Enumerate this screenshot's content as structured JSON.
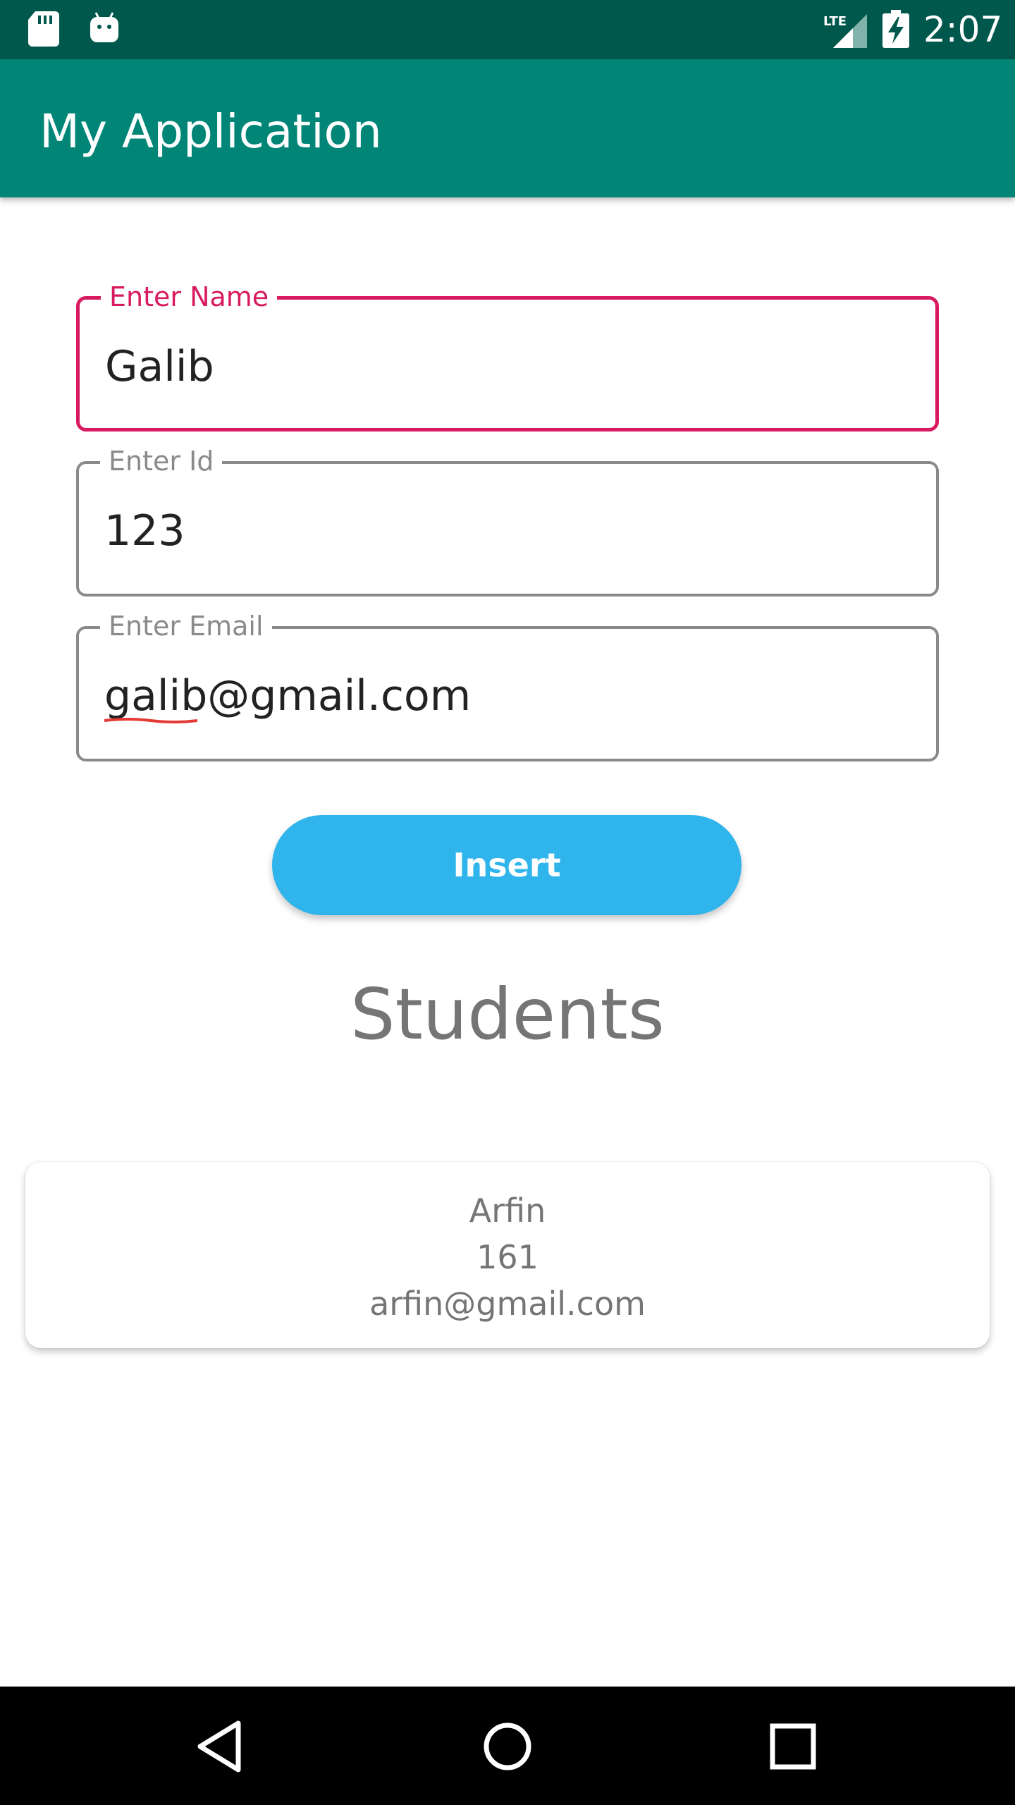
{
  "status_bar": {
    "time": "2:07",
    "network_label": "LTE",
    "icons": [
      "sd-card-icon",
      "android-icon",
      "lte-signal-icon",
      "battery-charging-icon"
    ]
  },
  "app_bar": {
    "title": "My Application"
  },
  "form": {
    "name": {
      "label": "Enter Name",
      "value": "Galib",
      "focused": true
    },
    "id": {
      "label": "Enter Id",
      "value": "123"
    },
    "email": {
      "label": "Enter Email",
      "value": "galib@gmail.com"
    },
    "insert_label": "Insert"
  },
  "students": {
    "heading": "Students",
    "items": [
      {
        "name": "Arfin",
        "id": "161",
        "email": "arfin@gmail.com"
      }
    ]
  },
  "nav_bar": {
    "icons": [
      "back-icon",
      "home-icon",
      "recents-icon"
    ]
  },
  "colors": {
    "status_bar": "#00574b",
    "app_bar": "#008577",
    "focus_accent": "#d81b60",
    "insert_button": "#2fb4ec",
    "spell_error": "#e53935"
  }
}
